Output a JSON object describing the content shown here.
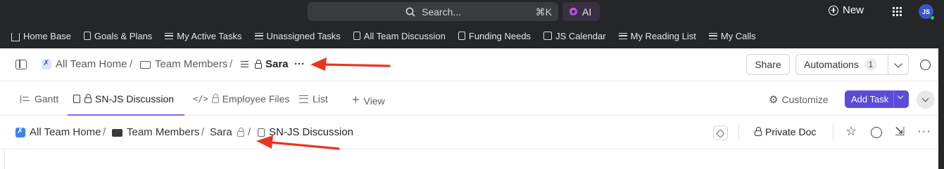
{
  "topbar": {
    "search_label": "Search...",
    "search_shortcut": "⌘K",
    "ai_label": "AI",
    "new_label": "New",
    "avatar_initials": "JS"
  },
  "bookmarks": [
    {
      "label": "Home Base",
      "icon": "home-icon"
    },
    {
      "label": "Goals & Plans",
      "icon": "doc-icon"
    },
    {
      "label": "My Active Tasks",
      "icon": "list-icon"
    },
    {
      "label": "Unassigned Tasks",
      "icon": "list-icon"
    },
    {
      "label": "All Team Discussion",
      "icon": "doc-icon"
    },
    {
      "label": "Funding Needs",
      "icon": "doc-icon"
    },
    {
      "label": "JS Calendar",
      "icon": "calendar-icon"
    },
    {
      "label": "My Reading List",
      "icon": "list-icon"
    },
    {
      "label": "My Calls",
      "icon": "list-icon"
    }
  ],
  "header": {
    "crumb_space": "All Team Home",
    "crumb_folder": "Team Members",
    "crumb_list": "Sara",
    "more": "···",
    "share_label": "Share",
    "automations_label": "Automations",
    "automations_count": "1"
  },
  "tabs": [
    {
      "label": "Gantt"
    },
    {
      "label": "SN-JS Discussion"
    },
    {
      "label": "Employee Files"
    },
    {
      "label": "List"
    },
    {
      "label": "View"
    }
  ],
  "tabs_right": {
    "customize_label": "Customize",
    "add_task_label": "Add Task"
  },
  "docbar": {
    "crumb_space": "All Team Home",
    "crumb_folder": "Team Members",
    "crumb_list": "Sara",
    "crumb_doc": "SN-JS Discussion",
    "private_label": "Private Doc"
  },
  "colors": {
    "accent": "#7b68ee",
    "add_task_bg": "#5b4bdb",
    "annotation_arrow": "#e8361f",
    "topbar_bg": "#252628"
  }
}
